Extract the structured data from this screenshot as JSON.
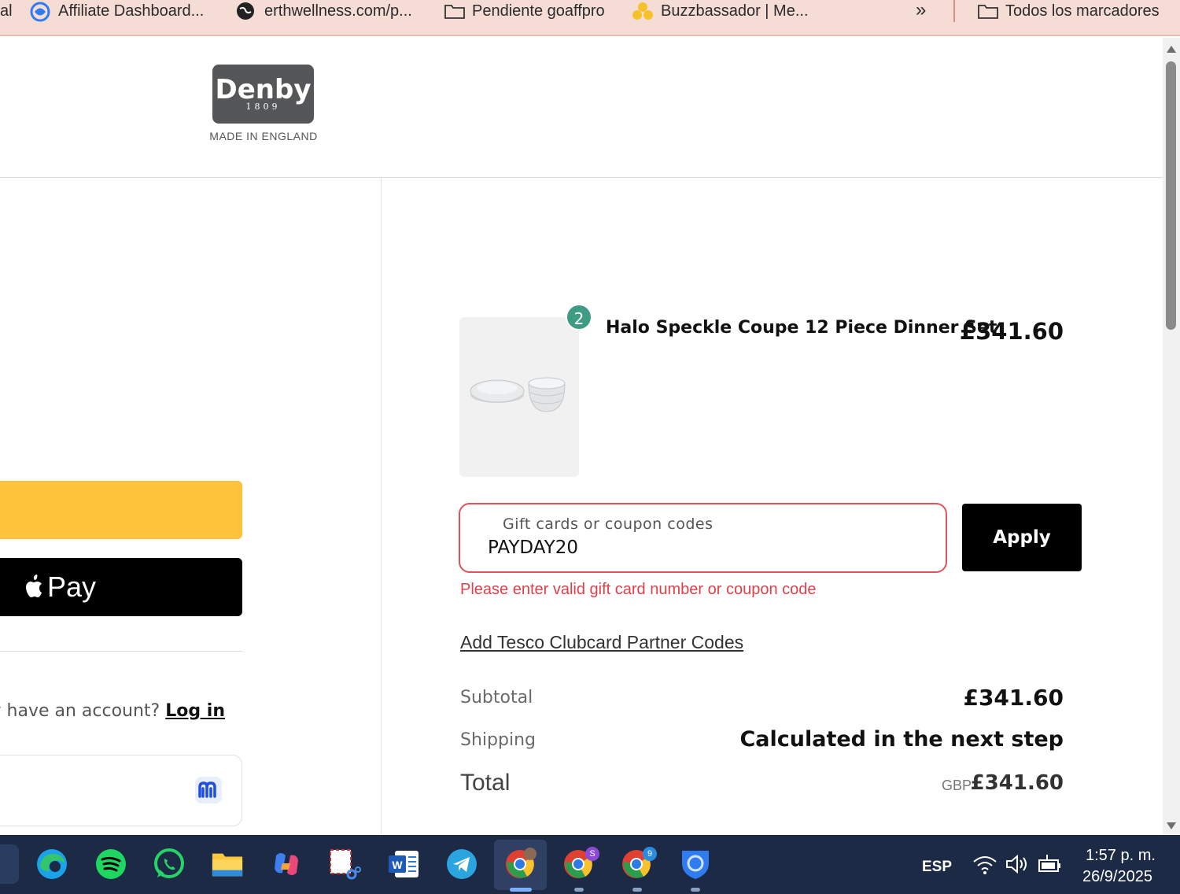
{
  "bookmarks": {
    "items": [
      {
        "label": "al",
        "icon": "none"
      },
      {
        "label": "Affiliate Dashboard...",
        "icon": "swirl-icon"
      },
      {
        "label": "erthwellness.com/p...",
        "icon": "globe-icon"
      },
      {
        "label": "Pendiente goaffpro",
        "icon": "folder-icon"
      },
      {
        "label": "Buzzbassador | Me...",
        "icon": "bees-icon"
      }
    ],
    "overflow": "»",
    "all_bookmarks": "Todos los marcadores"
  },
  "brand": {
    "name": "Denby",
    "year": "1809",
    "tagline": "MADE IN ENGLAND"
  },
  "express_checkout": {
    "apple_pay_label": "Pay"
  },
  "account": {
    "prompt": "dy have an account?",
    "login": "Log in"
  },
  "order": {
    "product_name": "Halo Speckle Coupe 12 Piece Dinner Set",
    "product_price": "£341.60",
    "quantity": "2"
  },
  "coupon": {
    "label": "Gift cards or coupon codes",
    "value": "PAYDAY20",
    "apply": "Apply",
    "error": "Please enter valid gift card number or coupon code"
  },
  "tesco_link": "Add Tesco Clubcard Partner Codes",
  "summary": {
    "subtotal_label": "Subtotal",
    "subtotal_value": "£341.60",
    "shipping_label": "Shipping",
    "shipping_value": "Calculated in the next step",
    "total_label": "Total",
    "total_currency": "GBP",
    "total_value": "£341.60"
  },
  "taskbar": {
    "apps": [
      "edge-icon",
      "spotify-icon",
      "whatsapp-icon",
      "file-explorer-icon",
      "copilot-icon",
      "snipping-tool-icon",
      "word-icon",
      "telegram-icon",
      "chrome-icon",
      "chrome-icon",
      "chrome-icon",
      "shield-icon"
    ],
    "chrome_badge_1": "S",
    "chrome_badge_2": "9",
    "language": "ESP",
    "time": "1:57 p. m.",
    "date": "26/9/2025"
  },
  "colors": {
    "accent_green": "#3e9c84",
    "error_red": "#e0404a",
    "shop_pay_yellow": "#fec33a",
    "taskbar": "#1c2a46"
  }
}
